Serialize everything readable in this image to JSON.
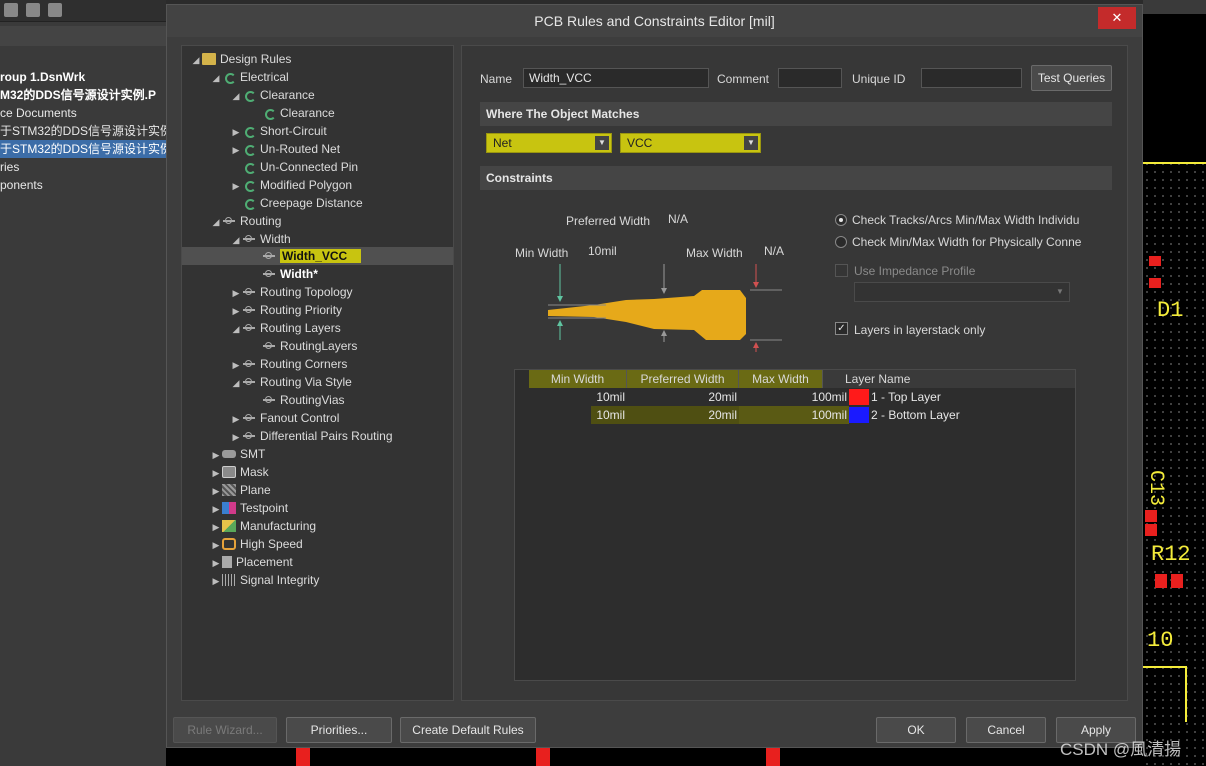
{
  "dialog": {
    "title": "PCB Rules and Constraints Editor [mil]",
    "close_label": "✕"
  },
  "background": {
    "project_lines": [
      "roup 1.DsnWrk",
      "M32的DDS信号源设计实例.P",
      "ce Documents",
      "于STM32的DDS信号源设计实例",
      "于STM32的DDS信号源设计实例",
      "ries",
      "ponents"
    ],
    "pcb_labels": [
      "D1",
      "C13",
      "R12",
      "10"
    ]
  },
  "tree": {
    "items": [
      {
        "label": "Design Rules",
        "arrow": "◢",
        "icon": "folder"
      },
      {
        "label": "Electrical",
        "arrow": "◢",
        "icon": "rule"
      },
      {
        "label": "Clearance",
        "arrow": "◢",
        "icon": "rule"
      },
      {
        "label": "Clearance",
        "arrow": "",
        "icon": "rule"
      },
      {
        "label": "Short-Circuit",
        "arrow": "▶",
        "icon": "rule"
      },
      {
        "label": "Un-Routed Net",
        "arrow": "▶",
        "icon": "rule"
      },
      {
        "label": "Un-Connected Pin",
        "arrow": "",
        "icon": "rule"
      },
      {
        "label": "Modified Polygon",
        "arrow": "▶",
        "icon": "rule"
      },
      {
        "label": "Creepage Distance",
        "arrow": "",
        "icon": "rule"
      },
      {
        "label": "Routing",
        "arrow": "◢",
        "icon": "route"
      },
      {
        "label": "Width",
        "arrow": "◢",
        "icon": "route"
      },
      {
        "label": "Width_VCC",
        "arrow": "",
        "icon": "route"
      },
      {
        "label": "Width*",
        "arrow": "",
        "icon": "route"
      },
      {
        "label": "Routing Topology",
        "arrow": "▶",
        "icon": "route"
      },
      {
        "label": "Routing Priority",
        "arrow": "▶",
        "icon": "route"
      },
      {
        "label": "Routing Layers",
        "arrow": "◢",
        "icon": "route"
      },
      {
        "label": "RoutingLayers",
        "arrow": "",
        "icon": "route"
      },
      {
        "label": "Routing Corners",
        "arrow": "▶",
        "icon": "route"
      },
      {
        "label": "Routing Via Style",
        "arrow": "◢",
        "icon": "route"
      },
      {
        "label": "RoutingVias",
        "arrow": "",
        "icon": "route"
      },
      {
        "label": "Fanout Control",
        "arrow": "▶",
        "icon": "route"
      },
      {
        "label": "Differential Pairs Routing",
        "arrow": "▶",
        "icon": "route"
      },
      {
        "label": "SMT",
        "arrow": "▶",
        "icon": "smt"
      },
      {
        "label": "Mask",
        "arrow": "▶",
        "icon": "mask"
      },
      {
        "label": "Plane",
        "arrow": "▶",
        "icon": "plane"
      },
      {
        "label": "Testpoint",
        "arrow": "▶",
        "icon": "testpoint"
      },
      {
        "label": "Manufacturing",
        "arrow": "▶",
        "icon": "mfg"
      },
      {
        "label": "High Speed",
        "arrow": "▶",
        "icon": "hs"
      },
      {
        "label": "Placement",
        "arrow": "▶",
        "icon": "place"
      },
      {
        "label": "Signal Integrity",
        "arrow": "▶",
        "icon": "signal"
      }
    ]
  },
  "rule": {
    "name_label": "Name",
    "name_value": "Width_VCC",
    "comment_label": "Comment",
    "comment_value": "",
    "uid_label": "Unique ID",
    "uid_value": "",
    "test_queries_label": "Test Queries"
  },
  "where": {
    "header": "Where The Object Matches",
    "type_value": "Net",
    "net_value": "VCC"
  },
  "constraints": {
    "header": "Constraints",
    "preferred_width_label": "Preferred Width",
    "preferred_width_value": "N/A",
    "min_width_label": "Min Width",
    "min_width_value": "10mil",
    "max_width_label": "Max Width",
    "max_width_value": "N/A",
    "radio1_label": "Check Tracks/Arcs Min/Max Width Individu",
    "radio2_label": "Check Min/Max Width for Physically Conne",
    "impedance_label": "Use Impedance Profile",
    "layerstack_label": "Layers in layerstack only",
    "check_mark": "✓",
    "colors": {
      "track": "#e6a91a",
      "arrow_green": "#5fc4a0",
      "arrow_red": "#d05050"
    }
  },
  "table": {
    "headers": [
      "Min Width",
      "Preferred Width",
      "Max Width",
      "Layer Name"
    ],
    "rows": [
      {
        "min": "10mil",
        "pref": "20mil",
        "max": "100mil",
        "layer": "1 - Top Layer",
        "color": "#ff1a1a"
      },
      {
        "min": "10mil",
        "pref": "20mil",
        "max": "100mil",
        "layer": "2 - Bottom Layer",
        "color": "#1a1aff"
      }
    ]
  },
  "buttons": {
    "rule_wizard": "Rule Wizard...",
    "priorities": "Priorities...",
    "create_default": "Create Default Rules",
    "ok": "OK",
    "cancel": "Cancel",
    "apply": "Apply"
  },
  "watermark": "CSDN @風清揚"
}
